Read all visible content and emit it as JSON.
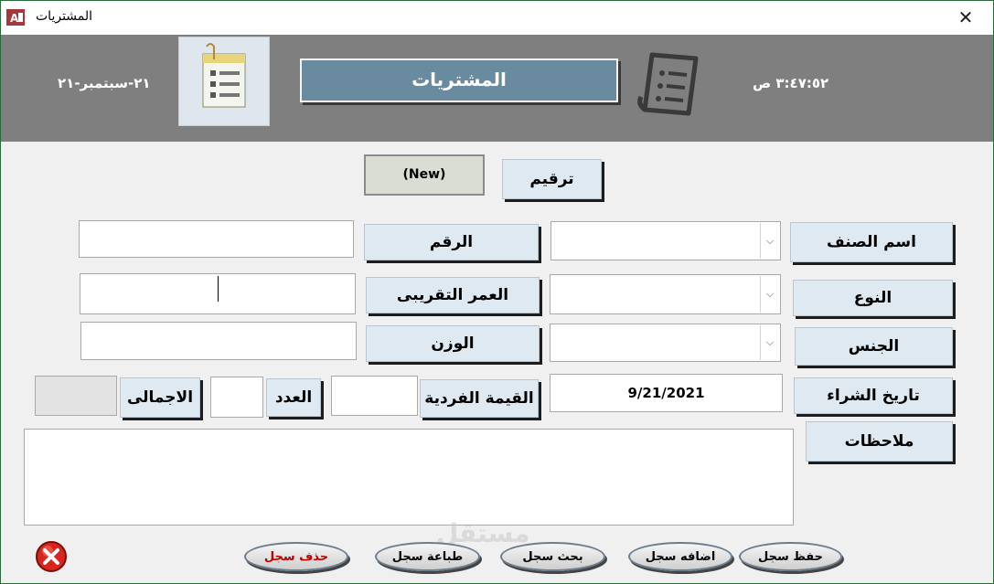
{
  "window": {
    "title": "المشتريات",
    "close_label": "✕"
  },
  "header": {
    "date": "٢١-سبتمبر-٢١",
    "time": "٣:٤٧:٥٢ ص",
    "title": "المشتريات"
  },
  "form": {
    "number_button": "ترقيم",
    "number_value": "(New)",
    "item_name_label": "اسم الصنف",
    "id_label": "الرقم",
    "type_label": "النوع",
    "approx_age_label": "العمر التقريبى",
    "gender_label": "الجنس",
    "weight_label": "الوزن",
    "purchase_date_label": "تاريخ الشراء",
    "purchase_date_value": "9/21/2021",
    "unit_value_label": "القيمة الفردية",
    "count_label": "العدد",
    "total_label": "الاجمالى",
    "notes_label": "ملاحظات"
  },
  "actions": {
    "save": "حفظ سجل",
    "add": "اضافه سجل",
    "search": "بحث سجل",
    "print": "طباعة سجل",
    "delete": "حذف سجل"
  },
  "watermark": "مستقل",
  "colors": {
    "header_bg": "#7f7f7f",
    "title_box": "#6a8aa0",
    "label_button_bg": "#dfe9f2",
    "delete_text": "#c00000"
  }
}
